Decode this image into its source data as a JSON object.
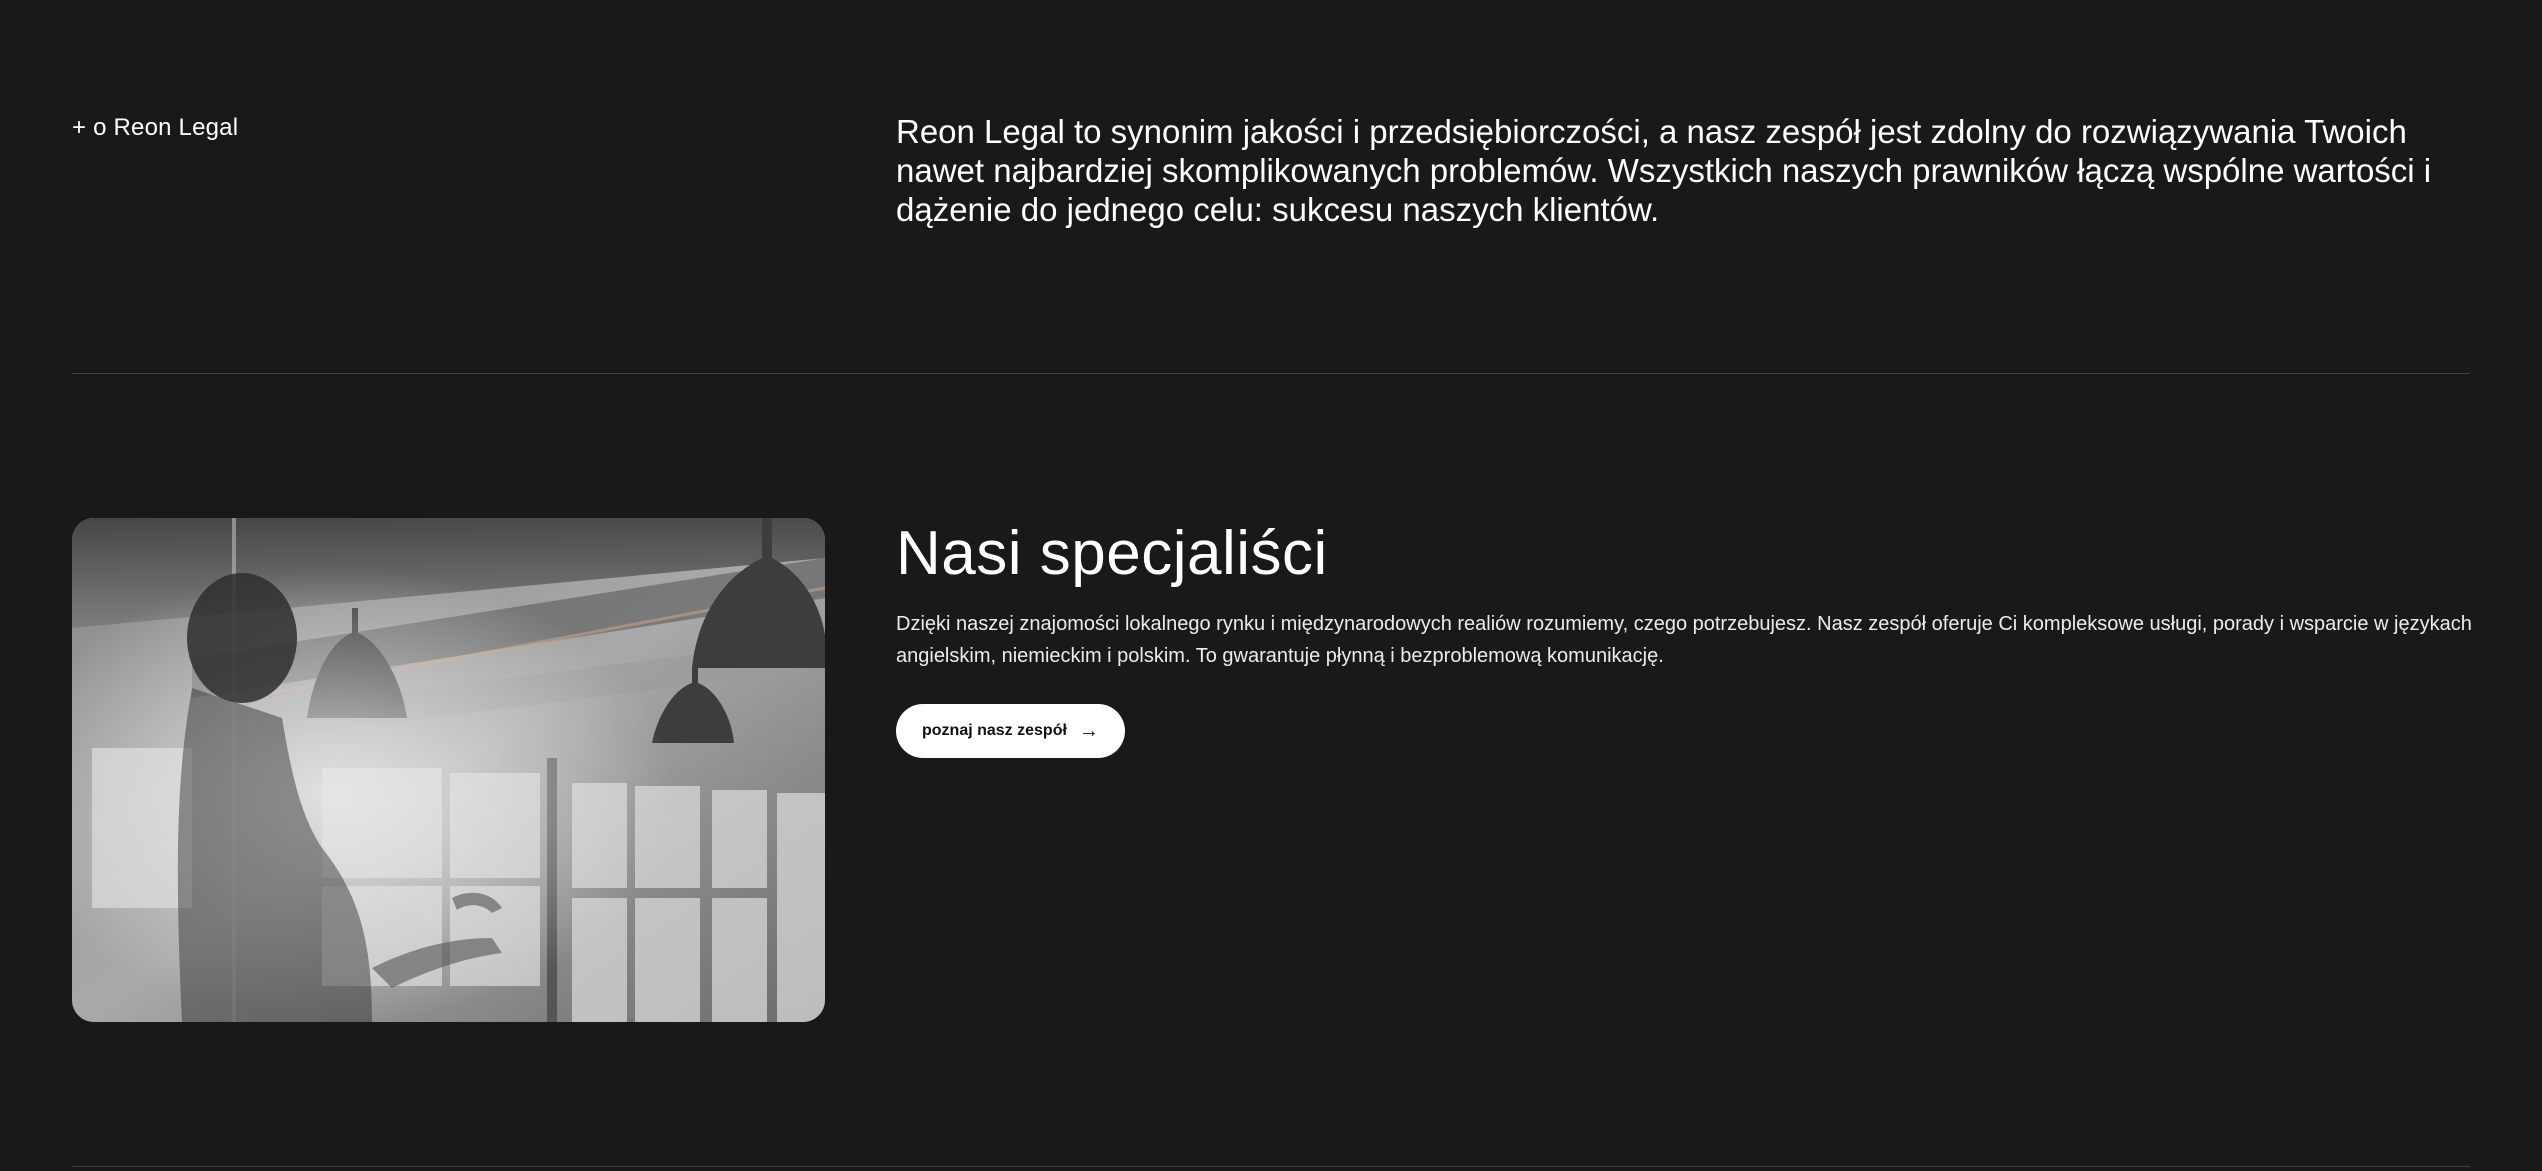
{
  "about": {
    "label": "+ o Reon Legal",
    "text": "Reon Legal to synonim jakości i przedsiębiorczości, a nasz zespół jest zdolny do rozwiązywania Twoich nawet najbardziej skomplikowanych problemów. Wszystkich naszych prawników łączą wspólne wartości i dążenie do jednego celu: sukcesu naszych klientów."
  },
  "specialists": {
    "title": "Nasi specjaliści",
    "description": "Dzięki naszej znajomości lokalnego rynku i międzynarodowych realiów rozumiemy, czego potrzebujesz. Nasz zespół oferuje Ci kompleksowe usługi, porady i wsparcie w językach angielskim, niemieckim i polskim. To gwarantuje płynną i bezproblemową komunikację.",
    "button_label": "poznaj nasz zespół",
    "button_icon": "arrow-right-icon"
  },
  "colors": {
    "background": "#191919",
    "divider": "#3f3f3f",
    "text": "#ffffff",
    "button_bg": "#ffffff",
    "button_text": "#111111"
  }
}
